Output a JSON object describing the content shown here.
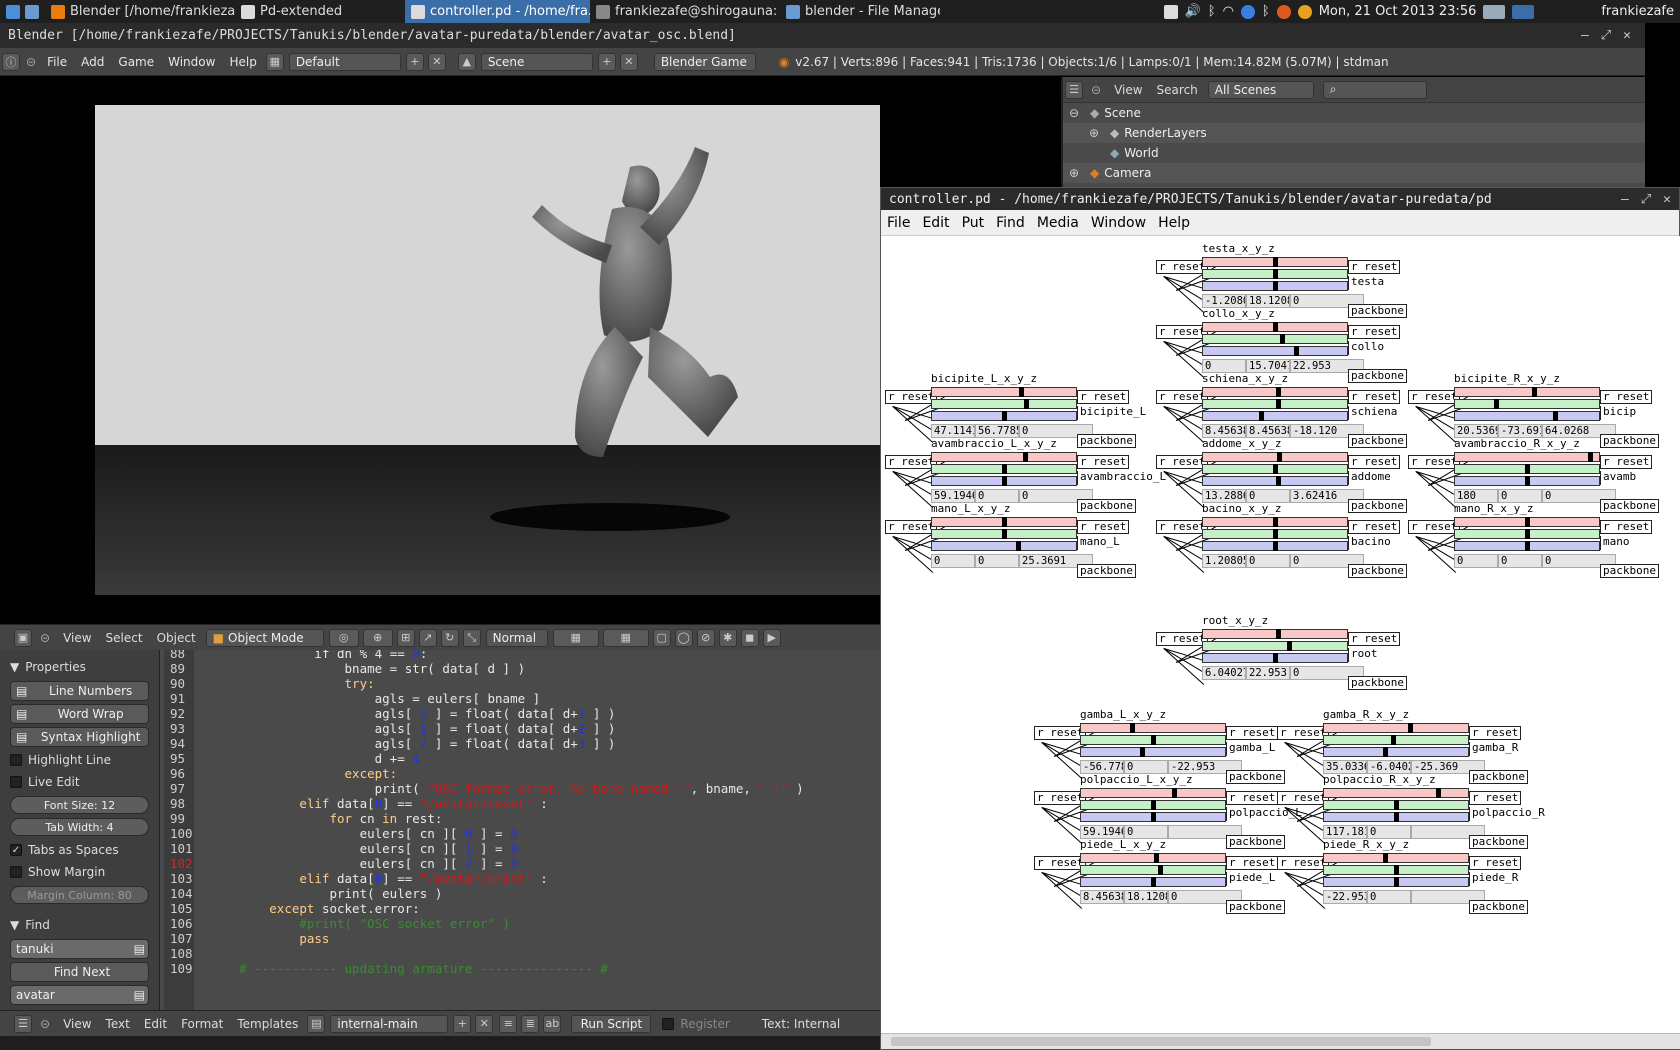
{
  "taskbar": {
    "windows": [
      {
        "label": "Blender [/home/frankiezaf...",
        "icon": "blender-icon"
      },
      {
        "label": "Pd-extended",
        "icon": "puredata-icon"
      },
      {
        "label": "controller.pd - /home/fra...",
        "icon": "puredata-icon",
        "active": true
      },
      {
        "label": "frankiezafe@shirogauna: ~...",
        "icon": "terminal-icon"
      },
      {
        "label": "blender - File Manager",
        "icon": "folder-icon"
      }
    ],
    "clock": "Mon, 21 Oct 2013 23:56",
    "user": "frankiezafe"
  },
  "blender": {
    "title": "Blender  [/home/frankiezafe/PROJECTS/Tanukis/blender/avatar-puredata/blender/avatar_osc.blend]",
    "menus": [
      "File",
      "Add",
      "Game",
      "Window",
      "Help"
    ],
    "layout": "Default",
    "scene": "Scene",
    "engine": "Blender Game",
    "stats": "v2.67 | Verts:896 | Faces:941 | Tris:1736 | Objects:1/6 | Lamps:0/1 | Mem:14.82M (5.07M) | stdman",
    "outliner": {
      "menus": [
        "View",
        "Search"
      ],
      "filter": "All Scenes",
      "rows": [
        "Scene",
        "RenderLayers",
        "World",
        "Camera"
      ]
    },
    "viewport_header": {
      "menus": [
        "View",
        "Select",
        "Object"
      ],
      "mode": "Object Mode",
      "orientation": "Normal"
    },
    "properties": {
      "title": "Properties",
      "buttons": [
        "Line Numbers",
        "Word Wrap",
        "Syntax Highlight"
      ],
      "checks": [
        {
          "label": "Highlight Line",
          "on": false
        },
        {
          "label": "Live Edit",
          "on": false
        }
      ],
      "font_size": "Font Size: 12",
      "tab_width": "Tab Width: 4",
      "checks2": [
        {
          "label": "Tabs as Spaces",
          "on": true
        },
        {
          "label": "Show Margin",
          "on": false
        }
      ],
      "margin": "Margin Column: 80",
      "find_title": "Find",
      "find_value": "tanuki",
      "find_next": "Find Next",
      "replace_value": "avatar"
    },
    "text_footer": {
      "menus": [
        "View",
        "Text",
        "Edit",
        "Format",
        "Templates"
      ],
      "file": "internal-main",
      "run": "Run Script",
      "register": "Register",
      "status": "Text: Internal"
    }
  },
  "code": [
    {
      "n": "88",
      "t": [
        [
          "                ",
          ""
        ],
        [
          "if",
          ""
        ],
        [
          " dn ",
          ""
        ],
        [
          "% 4 == ",
          ""
        ],
        [
          "0",
          "n"
        ],
        [
          ":",
          ""
        ]
      ]
    },
    {
      "n": "89",
      "t": [
        [
          "                    bname = str( data[ d ] )",
          ""
        ]
      ]
    },
    {
      "n": "90",
      "t": [
        [
          "                    ",
          ""
        ],
        [
          "try:",
          "k"
        ]
      ]
    },
    {
      "n": "91",
      "t": [
        [
          "                        agls = eulers[ bname ]",
          ""
        ]
      ]
    },
    {
      "n": "92",
      "t": [
        [
          "                        agls[ ",
          ""
        ],
        [
          "0",
          "n"
        ],
        [
          " ] = float( data[ d+",
          ""
        ],
        [
          "1",
          "n"
        ],
        [
          " ] )",
          ""
        ]
      ]
    },
    {
      "n": "93",
      "t": [
        [
          "                        agls[ ",
          ""
        ],
        [
          "1",
          "n"
        ],
        [
          " ] = float( data[ d+",
          ""
        ],
        [
          "2",
          "n"
        ],
        [
          " ] )",
          ""
        ]
      ]
    },
    {
      "n": "94",
      "t": [
        [
          "                        agls[ ",
          ""
        ],
        [
          "2",
          "n"
        ],
        [
          " ] = float( data[ d+",
          ""
        ],
        [
          "3",
          "n"
        ],
        [
          " ] )",
          ""
        ]
      ]
    },
    {
      "n": "95",
      "t": [
        [
          "                        d += ",
          ""
        ],
        [
          "4",
          "n"
        ]
      ]
    },
    {
      "n": "96",
      "t": [
        [
          "                    ",
          ""
        ],
        [
          "except:",
          "k"
        ]
      ]
    },
    {
      "n": "97",
      "t": [
        [
          "                        print( ",
          ""
        ],
        [
          "\"OSC format error, no bone named '\"",
          "s"
        ],
        [
          ", bname, ",
          ""
        ],
        [
          "\"'!\"",
          "s"
        ],
        [
          " )",
          ""
        ]
      ]
    },
    {
      "n": "98",
      "t": [
        [
          "              ",
          ""
        ],
        [
          "elif",
          "k"
        ],
        [
          " data[",
          ""
        ],
        [
          "0",
          "n"
        ],
        [
          "] == ",
          ""
        ],
        [
          "\"/avatar/reset\"",
          "s"
        ],
        [
          " :",
          ""
        ]
      ]
    },
    {
      "n": "99",
      "t": [
        [
          "                  ",
          ""
        ],
        [
          "for",
          "k"
        ],
        [
          " cn ",
          ""
        ],
        [
          "in",
          "k"
        ],
        [
          " rest:",
          ""
        ]
      ]
    },
    {
      "n": "100",
      "t": [
        [
          "                      eulers[ cn ][ ",
          ""
        ],
        [
          "0",
          "n"
        ],
        [
          " ] = ",
          ""
        ],
        [
          "0",
          "n"
        ]
      ]
    },
    {
      "n": "101",
      "t": [
        [
          "                      eulers[ cn ][ ",
          ""
        ],
        [
          "1",
          "n"
        ],
        [
          " ] = ",
          ""
        ],
        [
          "0",
          "n"
        ]
      ]
    },
    {
      "n": "102",
      "t": [
        [
          "                      eulers[ cn ][ ",
          ""
        ],
        [
          "2",
          "n"
        ],
        [
          " ] = ",
          ""
        ],
        [
          "0",
          "n"
        ]
      ]
    },
    {
      "n": "103",
      "t": [
        [
          "              ",
          ""
        ],
        [
          "elif",
          "k"
        ],
        [
          " data[",
          ""
        ],
        [
          "0",
          "n"
        ],
        [
          "] == ",
          ""
        ],
        [
          "\"/avatar/print\"",
          "s"
        ],
        [
          " :",
          ""
        ]
      ]
    },
    {
      "n": "104",
      "t": [
        [
          "                  print( eulers )",
          ""
        ]
      ]
    },
    {
      "n": "105",
      "t": [
        [
          "          ",
          ""
        ],
        [
          "except",
          "k"
        ],
        [
          " socket.error:",
          ""
        ]
      ]
    },
    {
      "n": "106",
      "t": [
        [
          "              ",
          ""
        ],
        [
          "#print( \"OSC socket error\" )",
          "c"
        ]
      ]
    },
    {
      "n": "107",
      "t": [
        [
          "              ",
          ""
        ],
        [
          "pass",
          "k"
        ]
      ]
    },
    {
      "n": "108",
      "t": [
        [
          "",
          ""
        ]
      ]
    },
    {
      "n": "109",
      "t": [
        [
          "      ",
          ""
        ],
        [
          "# ----------- updating armature --------------- #",
          "c"
        ]
      ]
    }
  ],
  "pd": {
    "title": "controller.pd   - /home/frankiezafe/PROJECTS/Tanukis/blender/avatar-puredata/pd",
    "menus": [
      "File",
      "Edit",
      "Put",
      "Find",
      "Media",
      "Window",
      "Help"
    ],
    "reset": "r reset",
    "reset_out": "r reset",
    "packbone": "packbone",
    "groups": [
      {
        "id": "testa",
        "label": "testa_x_y_z",
        "bone": "testa",
        "vals": [
          "-1.2080",
          "18.1208",
          "0"
        ],
        "knobs": [
          0.5,
          0.5,
          0.5
        ]
      },
      {
        "id": "collo",
        "label": "collo_x_y_z",
        "bone": "collo",
        "vals": [
          "0",
          "15.7047",
          "22.953"
        ],
        "knobs": [
          0.5,
          0.55,
          0.65
        ]
      },
      {
        "id": "bicipite_L",
        "label": "bicipite_L_x_y_z",
        "bone": "bicipite_L",
        "vals": [
          "47.1141",
          "56.7785",
          "0"
        ],
        "knobs": [
          0.62,
          0.66,
          0.5
        ]
      },
      {
        "id": "schiena",
        "label": "schiena_x_y_z",
        "bone": "schiena",
        "vals": [
          "8.45638",
          "8.45638",
          "-18.120"
        ],
        "knobs": [
          0.52,
          0.52,
          0.4
        ]
      },
      {
        "id": "bicipite_R",
        "label": "bicipite_R_x_y_z",
        "bone": "bicip",
        "vals": [
          "20.5369",
          "-73.691",
          "64.0268"
        ],
        "knobs": [
          0.55,
          0.28,
          0.7
        ]
      },
      {
        "id": "avambraccio_L",
        "label": "avambraccio_L_x_y_z",
        "bone": "avambraccio_L",
        "vals": [
          "59.1946",
          "0",
          "0"
        ],
        "knobs": [
          0.65,
          0.5,
          0.5
        ]
      },
      {
        "id": "addome",
        "label": "addome_x_y_z",
        "bone": "addome",
        "vals": [
          "13.2886",
          "0",
          "3.62416"
        ],
        "knobs": [
          0.53,
          0.5,
          0.52
        ]
      },
      {
        "id": "avambraccio_R",
        "label": "avambraccio_R_x_y_z",
        "bone": "avamb",
        "vals": [
          "180",
          "0",
          "0"
        ],
        "knobs": [
          0.95,
          0.5,
          0.5
        ]
      },
      {
        "id": "mano_L",
        "label": "mano_L_x_y_z",
        "bone": "mano_L",
        "vals": [
          "0",
          "0",
          "25.3691"
        ],
        "knobs": [
          0.5,
          0.5,
          0.6
        ]
      },
      {
        "id": "bacino",
        "label": "bacino_x_y_z",
        "bone": "bacino",
        "vals": [
          "1.20805",
          "0",
          "0"
        ],
        "knobs": [
          0.5,
          0.5,
          0.5
        ]
      },
      {
        "id": "mano_R",
        "label": "mano_R_x_y_z",
        "bone": "mano",
        "vals": [
          "0",
          "0",
          "0"
        ],
        "knobs": [
          0.5,
          0.5,
          0.5
        ]
      },
      {
        "id": "root",
        "label": "root_x_y_z",
        "bone": "root",
        "vals": [
          "6.04027",
          "22.953",
          "0"
        ],
        "knobs": [
          0.52,
          0.6,
          0.5
        ]
      },
      {
        "id": "gamba_L",
        "label": "gamba_L_x_y_z",
        "bone": "gamba_L",
        "vals": [
          "-56.778",
          "0",
          "-22.953"
        ],
        "knobs": [
          0.35,
          0.5,
          0.42
        ]
      },
      {
        "id": "gamba_R",
        "label": "gamba_R_x_y_z",
        "bone": "gamba_R",
        "vals": [
          "35.0336",
          "-6.0402",
          "-25.369"
        ],
        "knobs": [
          0.6,
          0.48,
          0.42
        ]
      },
      {
        "id": "polpaccio_L",
        "label": "polpaccio_L_x_y_z",
        "bone": "polpaccio_L",
        "vals": [
          "59.1946",
          "0",
          ""
        ],
        "knobs": [
          0.65,
          0.5,
          0.5
        ]
      },
      {
        "id": "polpaccio_R",
        "label": "polpaccio_R_x_y_z",
        "bone": "polpaccio_R",
        "vals": [
          "117.181",
          "0",
          ""
        ],
        "knobs": [
          0.8,
          0.5,
          0.5
        ]
      },
      {
        "id": "piede_L",
        "label": "piede_L_x_y_z",
        "bone": "piede_L",
        "vals": [
          "8.45638",
          "18.1208",
          "0"
        ],
        "knobs": [
          0.52,
          0.55,
          0.5
        ]
      },
      {
        "id": "piede_R",
        "label": "piede_R_x_y_z",
        "bone": "piede_R",
        "vals": [
          "-22.953",
          "0",
          ""
        ],
        "knobs": [
          0.42,
          0.5,
          0.5
        ]
      }
    ]
  }
}
